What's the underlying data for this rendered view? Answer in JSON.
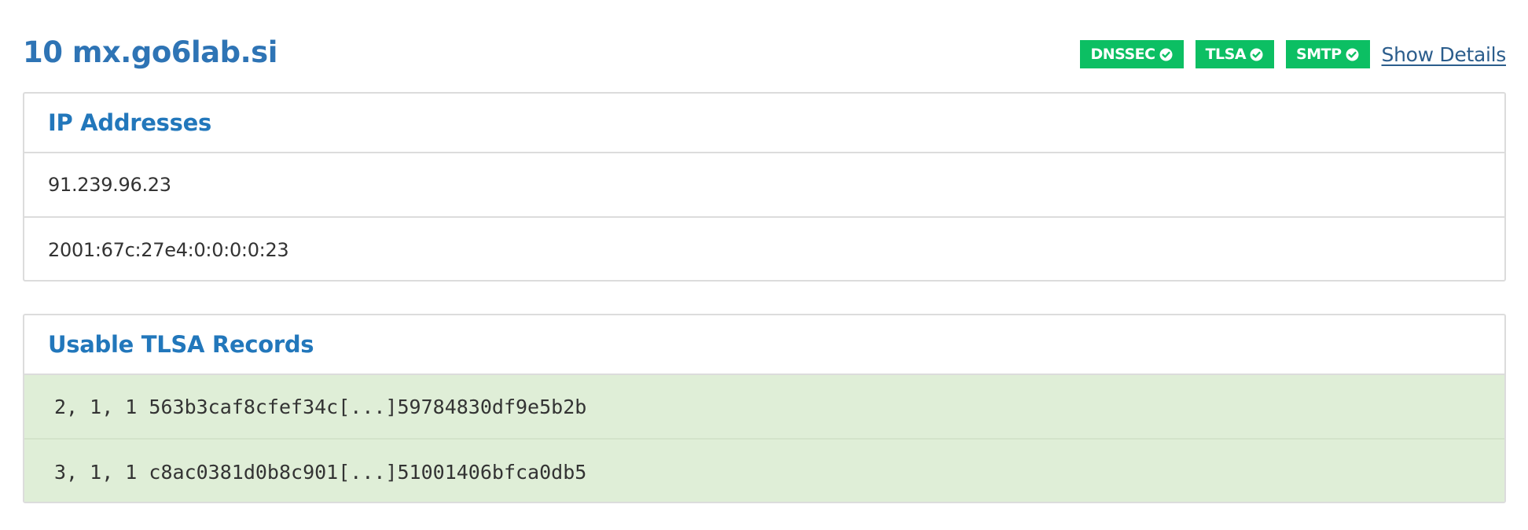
{
  "mx": {
    "title": "10 mx.go6lab.si",
    "badges": [
      {
        "label": "DNSSEC",
        "icon": "check-circle-icon",
        "status": "ok"
      },
      {
        "label": "TLSA",
        "icon": "check-circle-icon",
        "status": "ok"
      },
      {
        "label": "SMTP",
        "icon": "check-circle-icon",
        "status": "ok"
      }
    ],
    "show_details_label": "Show Details"
  },
  "ip_panel": {
    "title": "IP Addresses",
    "addresses": [
      "91.239.96.23",
      "2001:67c:27e4:0:0:0:0:23"
    ]
  },
  "tlsa_panel": {
    "title": "Usable TLSA Records",
    "records": [
      "2, 1, 1 563b3caf8cfef34c[...]59784830df9e5b2b",
      "3, 1, 1 c8ac0381d0b8c901[...]51001406bfca0db5"
    ]
  },
  "colors": {
    "title": "#2e74b5",
    "panel_title": "#2277bb",
    "badge_ok": "#0cbf63",
    "tlsa_row_bg": "#dfeed7",
    "link": "#2b5d8c"
  }
}
